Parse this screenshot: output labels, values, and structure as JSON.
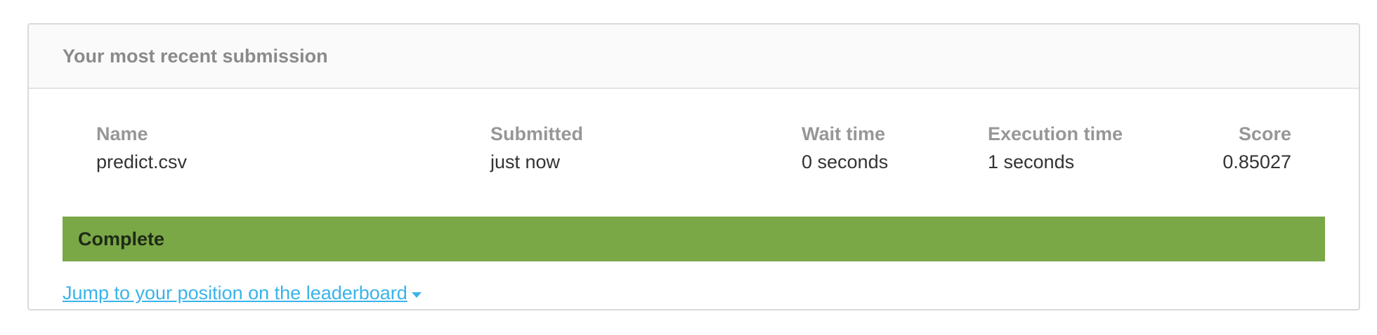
{
  "submission": {
    "title": "Your most recent submission",
    "columns": [
      {
        "label": "Name",
        "value": "predict.csv"
      },
      {
        "label": "Submitted",
        "value": "just now"
      },
      {
        "label": "Wait time",
        "value": "0 seconds"
      },
      {
        "label": "Execution time",
        "value": "1 seconds"
      },
      {
        "label": "Score",
        "value": "0.85027"
      }
    ],
    "status": "Complete",
    "status_color": "#7aa847",
    "leaderboard_link": "Jump to your position on the leaderboard",
    "link_icon": "caret-down-icon",
    "link_color": "#3ab3ea"
  }
}
